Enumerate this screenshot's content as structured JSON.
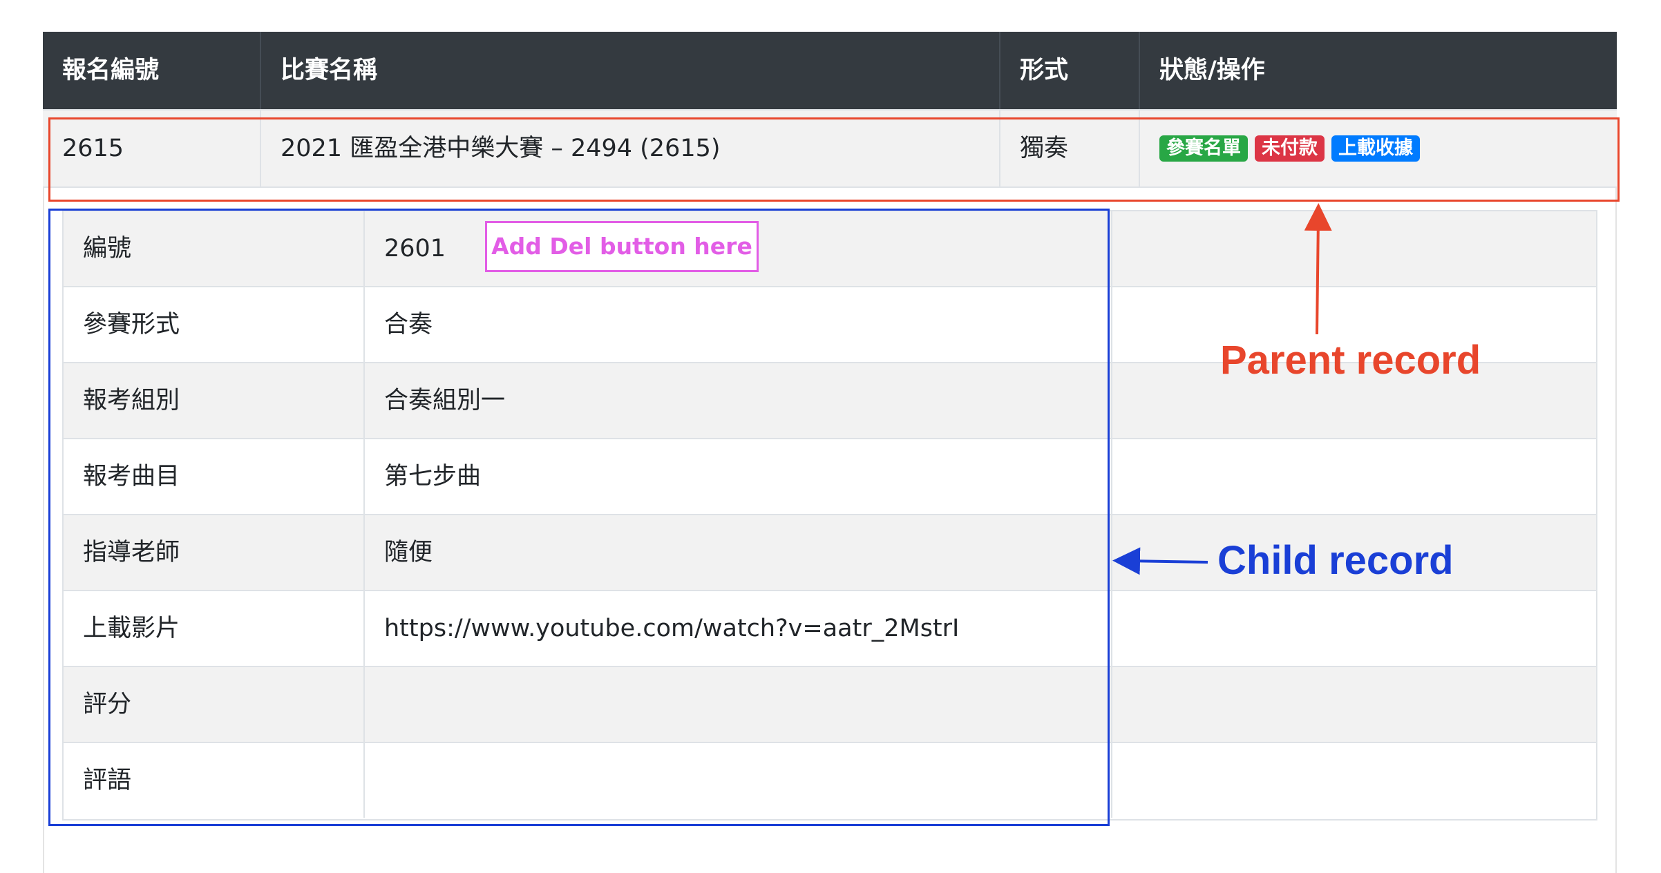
{
  "table": {
    "headers": [
      "報名編號",
      "比賽名稱",
      "形式",
      "狀態/操作"
    ],
    "parent_row": {
      "id": "2615",
      "name": "2021 匯盈全港中樂大賽 – 2494 (2615)",
      "format": "獨奏",
      "badges": [
        {
          "label": "參賽名單",
          "color": "#28a745"
        },
        {
          "label": "未付款",
          "color": "#dc3545"
        },
        {
          "label": "上載收據",
          "color": "#007bff"
        }
      ]
    },
    "child_rows": [
      {
        "label": "編號",
        "value": "2601"
      },
      {
        "label": "參賽形式",
        "value": "合奏"
      },
      {
        "label": "報考組別",
        "value": "合奏組別一"
      },
      {
        "label": "報考曲目",
        "value": "第七步曲"
      },
      {
        "label": "指導老師",
        "value": "隨便"
      },
      {
        "label": "上載影片",
        "value": "https://www.youtube.com/watch?v=aatr_2MstrI"
      },
      {
        "label": "評分",
        "value": ""
      },
      {
        "label": "評語",
        "value": ""
      }
    ]
  },
  "annotations": {
    "add_del_note": "Add Del button here",
    "parent_label": "Parent record",
    "child_label": "Child record",
    "colors": {
      "parent": "#e8462c",
      "child": "#1a3fd6",
      "note": "#e25de6"
    }
  }
}
